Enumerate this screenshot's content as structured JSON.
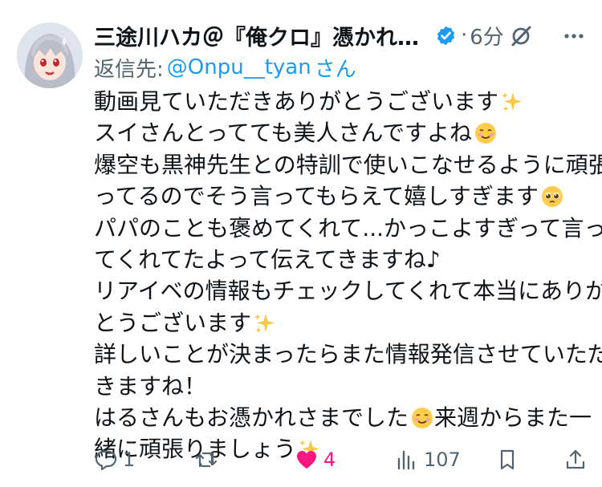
{
  "post": {
    "author_name": "三途川ハカ＠『俺クロ』憑かれた...",
    "timestamp": "6分",
    "reply_to_label": "返信先:",
    "reply_to_handle": "@Onpu__tyan",
    "reply_to_suffix": "さん",
    "verified": true,
    "body_lines": [
      {
        "text": "動画見ていただきありがとうございます",
        "emoji": "sparkles"
      },
      {
        "text": "スイさんとってても美人さんですよね",
        "emoji": "smiling-face"
      },
      {
        "text": "爆空も黒神先生との特訓で使いこなせるように頑張",
        "emoji": null
      },
      {
        "text": "ってるのでそう言ってもらえて嬉しすぎます",
        "emoji": "pleading-face"
      },
      {
        "text": "パパのことも褒めてくれて...かっこよすぎって言っ",
        "emoji": null
      },
      {
        "text": "てくれてたよって伝えてきますね♪",
        "emoji": null
      },
      {
        "text": "リアイベの情報もチェックしてくれて本当にありが",
        "emoji": null
      },
      {
        "text": "とうございます",
        "emoji": "sparkles"
      },
      {
        "text": "詳しいことが決まったらまた情報発信させていただ",
        "emoji": null
      },
      {
        "text": "きますね！",
        "emoji": null
      },
      {
        "text": "はるさんもお憑かれさまでした",
        "emoji": "smiling-face",
        "after": "来週からまた一"
      },
      {
        "text": "緒に頑張りましょう",
        "emoji": "sparkles"
      }
    ]
  },
  "actions": {
    "reply_count": "1",
    "repost_count": "",
    "like_count": "4",
    "view_count": "107"
  },
  "colors": {
    "accent": "#1d9bf0",
    "like": "#f91880",
    "muted": "#536471",
    "text": "#0f1419"
  }
}
